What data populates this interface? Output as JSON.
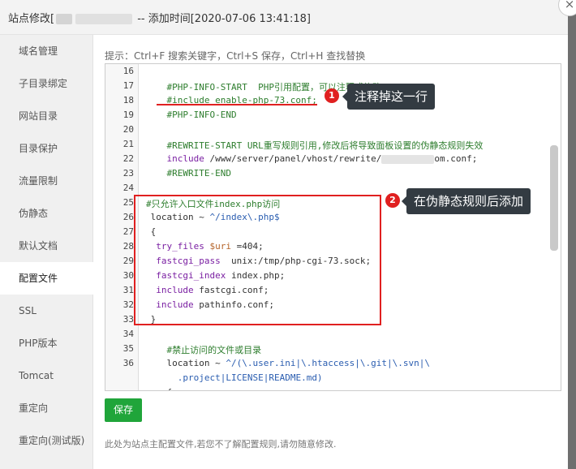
{
  "window": {
    "title_prefix": "站点修改[",
    "title_suffix": " -- 添加时间[2020-07-06 13:41:18]",
    "close_symbol": "×"
  },
  "sidebar": {
    "items": [
      {
        "label": "域名管理",
        "active": false
      },
      {
        "label": "子目录绑定",
        "active": false
      },
      {
        "label": "网站目录",
        "active": false
      },
      {
        "label": "目录保护",
        "active": false
      },
      {
        "label": "流量限制",
        "active": false
      },
      {
        "label": "伪静态",
        "active": false
      },
      {
        "label": "默认文档",
        "active": false
      },
      {
        "label": "配置文件",
        "active": true
      },
      {
        "label": "SSL",
        "active": false
      },
      {
        "label": "PHP版本",
        "active": false
      },
      {
        "label": "Tomcat",
        "active": false
      },
      {
        "label": "重定向",
        "active": false
      },
      {
        "label": "重定向(测试版)",
        "active": false
      }
    ]
  },
  "hint": "提示：Ctrl+F 搜索关键字，Ctrl+S 保存，Ctrl+H 查找替换",
  "editor": {
    "line_numbers": [
      "16",
      "17",
      "18",
      "19",
      "20",
      "21",
      "22",
      "23",
      "24",
      "25",
      "26",
      "27",
      "28",
      "29",
      "30",
      "31",
      "32",
      "33",
      "34",
      "35",
      "36",
      "",
      ""
    ],
    "lines": {
      "l17": "    #PHP-INFO-START  PHP引用配置，可以注释或修改",
      "l18": "    #include enable-php-73.conf;",
      "l19": "    #PHP-INFO-END",
      "l21": "    #REWRITE-START URL重写规则引用,修改后将导致面板设置的伪静态规则失效",
      "l22_kw": "include",
      "l22_a": " /www/server/panel/vhost/rewrite/",
      "l22_b": "om.conf;",
      "l23": "    #REWRITE-END",
      "l25": "#只允许入口文件index.php访问",
      "l26_a": "location ~ ",
      "l26_b": "^/index\\.php$",
      "l27": "{",
      "l28_kw": "try_files",
      "l28_var": "$uri",
      "l28_rest": " =404;",
      "l29_kw": "fastcgi_pass",
      "l29_rest": "  unix:/tmp/php-cgi-73.sock;",
      "l30_kw": "fastcgi_index",
      "l30_rest": " index.php;",
      "l31_kw": "include",
      "l31_rest": " fastcgi.conf;",
      "l32_kw": "include",
      "l32_rest": " pathinfo.conf;",
      "l33": "}",
      "l35": "    #禁止访问的文件或目录",
      "l36_a": "location ~ ",
      "l36_b": "^/(\\.user.ini|\\.htaccess|\\.git|\\.svn|\\",
      "l36c": ".project|LICENSE|README.md)",
      "l37": "{"
    }
  },
  "annotations": {
    "badge1": "1",
    "tip1": "注释掉这一行",
    "badge2": "2",
    "tip2": "在伪静态规则后添加"
  },
  "save_label": "保存",
  "footnote": "此处为站点主配置文件,若您不了解配置规则,请勿随意修改.",
  "colors": {
    "accent_green": "#20a53a",
    "annotation_red": "#e02020"
  }
}
